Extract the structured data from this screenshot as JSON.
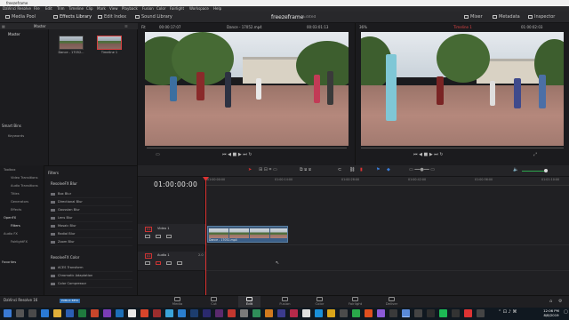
{
  "window": {
    "title": "freezeframe"
  },
  "menu": [
    "DaVinci Resolve",
    "File",
    "Edit",
    "Trim",
    "Timeline",
    "Clip",
    "Mark",
    "View",
    "Playback",
    "Fusion",
    "Color",
    "Fairlight",
    "Workspace",
    "Help"
  ],
  "toolbar": {
    "media_pool": "Media Pool",
    "effects_library": "Effects Library",
    "edit_index": "Edit Index",
    "sound_library": "Sound Library",
    "mixer": "Mixer",
    "metadata": "Metadata",
    "inspector": "Inspector"
  },
  "project": {
    "name": "freezeframe",
    "status": "Edited"
  },
  "media_pool": {
    "bin_selector": "Master",
    "bins": [
      "Master"
    ],
    "smart_bins_title": "Smart Bins",
    "smart_bins": [
      "Keywords"
    ],
    "clips": [
      {
        "label": "Dance - 17052..."
      },
      {
        "label": "Timeline 1"
      }
    ]
  },
  "source_viewer": {
    "fit": "Fit",
    "timecode_in": "00:00:17:07",
    "clip": "Dance - 17052.mp4",
    "timecode_out": "00:03:01:13"
  },
  "timeline_viewer": {
    "zoom": "36%",
    "timeline": "Timeline 1",
    "timecode": "01:00:02:03"
  },
  "effects": {
    "nav": [
      {
        "label": "Toolbox"
      },
      {
        "label": "Video Transitions"
      },
      {
        "label": "Audio Transitions"
      },
      {
        "label": "Titles"
      },
      {
        "label": "Generators"
      },
      {
        "label": "Effects"
      },
      {
        "label": "OpenFX"
      },
      {
        "label": "Filters"
      },
      {
        "label": "Audio FX"
      },
      {
        "label": "FairlightFX"
      }
    ],
    "favorites": "Favorites",
    "panel_title": "Filters",
    "group1": "ResolveFX Blur",
    "group1_items": [
      "Box Blur",
      "Directional Blur",
      "Gaussian Blur",
      "Lens Blur",
      "Mosaic Blur",
      "Radial Blur",
      "Zoom Blur"
    ],
    "group2": "ResolveFX Color",
    "group2_items": [
      "ACES Transform",
      "Chromatic Adaptation",
      "Color Compressor"
    ]
  },
  "timeline": {
    "timecode": "01:00:00:00",
    "ruler": [
      "01:00:00:00",
      "01:00:14:00",
      "01:00:28:00",
      "01:00:42:00",
      "01:00:56:00",
      "01:01:10:00"
    ],
    "tracks": [
      {
        "tag": "V1",
        "name": "Video 1"
      },
      {
        "tag": "A1",
        "name": "Audio 1",
        "level": "2.0"
      }
    ],
    "clip_label": "Dance - 17052.mp4"
  },
  "pages": [
    "Media",
    "Cut",
    "Edit",
    "Fusion",
    "Color",
    "Fairlight",
    "Deliver"
  ],
  "active_page": "Edit",
  "app_brand": "DaVinci Resolve 16",
  "beta_badge": "PUBLIC BETA",
  "clock": {
    "time": "12:06 PM",
    "date": "8/8/2019"
  }
}
